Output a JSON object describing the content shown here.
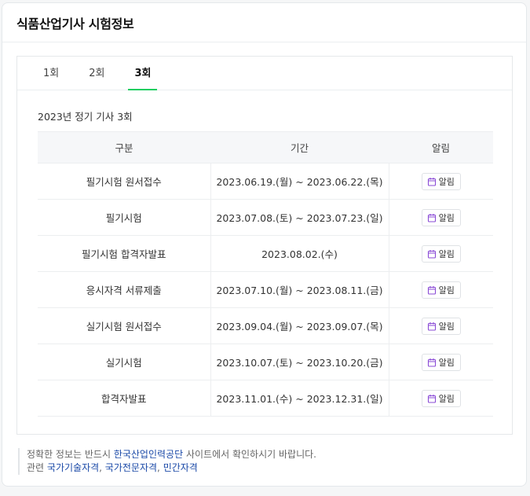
{
  "card": {
    "title": "식품산업기사 시험정보"
  },
  "tabs": [
    {
      "label": "1회",
      "active": false
    },
    {
      "label": "2회",
      "active": false
    },
    {
      "label": "3회",
      "active": true
    }
  ],
  "section": {
    "title": "2023년 정기 기사 3회"
  },
  "table": {
    "headers": [
      "구분",
      "기간",
      "알림"
    ],
    "alarm_label": "알림",
    "rows": [
      {
        "name": "필기시험 원서접수",
        "period": "2023.06.19.(월) ~ 2023.06.22.(목)"
      },
      {
        "name": "필기시험",
        "period": "2023.07.08.(토) ~ 2023.07.23.(일)"
      },
      {
        "name": "필기시험 합격자발표",
        "period": "2023.08.02.(수)"
      },
      {
        "name": "응시자격 서류제출",
        "period": "2023.07.10.(월) ~ 2023.08.11.(금)"
      },
      {
        "name": "실기시험 원서접수",
        "period": "2023.09.04.(월) ~ 2023.09.07.(목)"
      },
      {
        "name": "실기시험",
        "period": "2023.10.07.(토) ~ 2023.10.20.(금)"
      },
      {
        "name": "합격자발표",
        "period": "2023.11.01.(수) ~ 2023.12.31.(일)"
      }
    ]
  },
  "notice": {
    "line1_prefix": "정확한 정보는 반드시 ",
    "line1_link": "한국산업인력공단",
    "line1_suffix": " 사이트에서 확인하시기 바랍니다.",
    "line2_prefix": "관련 ",
    "links": [
      "국가기술자격",
      "국가전문자격",
      "민간자격"
    ]
  },
  "colors": {
    "tab_active": "#19ce60",
    "link": "#1a49a7",
    "calendar_icon": "#8a4bd6"
  }
}
